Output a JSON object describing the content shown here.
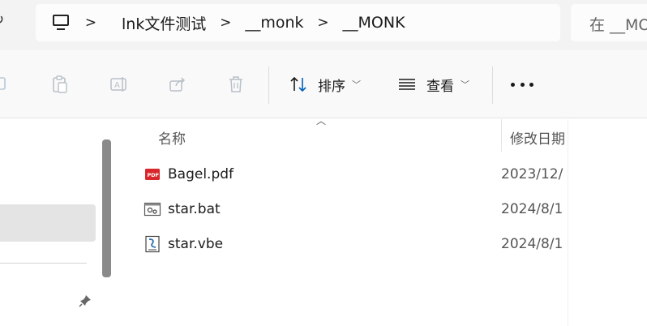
{
  "address_bar": {
    "breadcrumbs": [
      "lnk文件测试",
      "__monk",
      "__MONK"
    ],
    "separator": ">"
  },
  "search": {
    "placeholder": "在 __MONK 中搜索"
  },
  "toolbar": {
    "sort_label": "排序",
    "view_label": "查看"
  },
  "columns": {
    "name": "名称",
    "date_modified": "修改日期"
  },
  "files": [
    {
      "name": "Bagel.pdf",
      "date": "2023/12/",
      "icon": "pdf-file-icon"
    },
    {
      "name": "star.bat",
      "date": "2024/8/1",
      "icon": "batch-file-icon"
    },
    {
      "name": "star.vbe",
      "date": "2024/8/1",
      "icon": "script-file-icon"
    }
  ],
  "colors": {
    "accent": "#005fb8",
    "pdf_red": "#d9262b",
    "selection": "#e4e4e4"
  }
}
